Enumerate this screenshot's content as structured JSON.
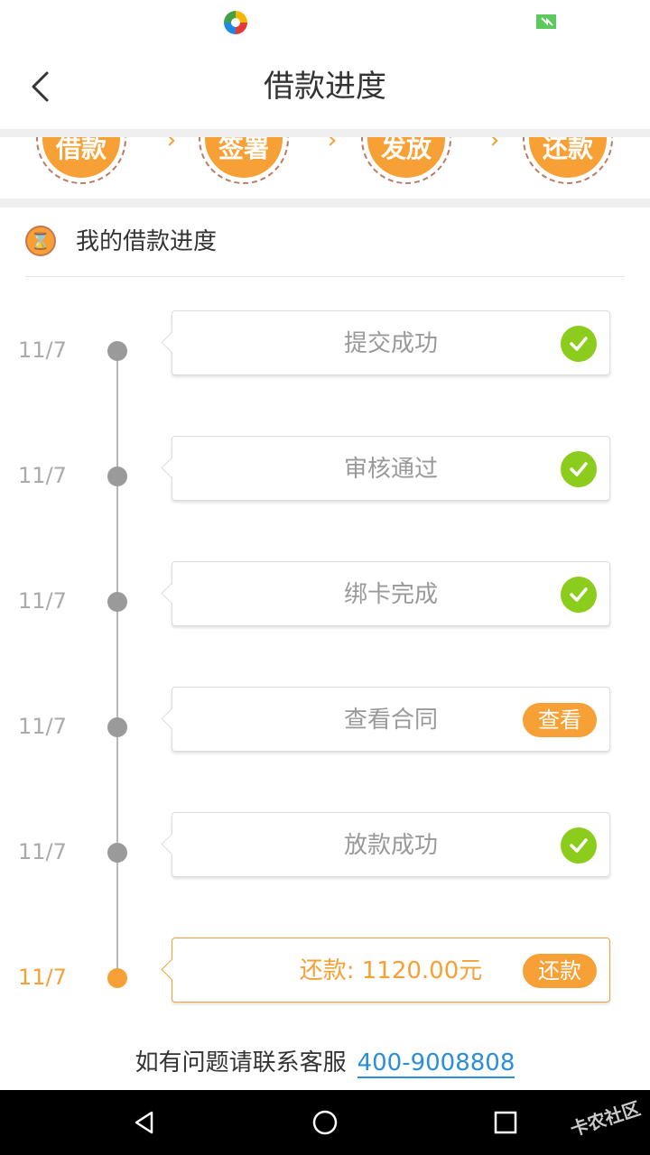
{
  "header": {
    "title": "借款进度"
  },
  "steps": [
    "借款",
    "签署",
    "发放",
    "还款"
  ],
  "section": {
    "title": "我的借款进度"
  },
  "timeline": [
    {
      "date": "11/7",
      "label": "提交成功",
      "status": "done"
    },
    {
      "date": "11/7",
      "label": "审核通过",
      "status": "done"
    },
    {
      "date": "11/7",
      "label": "绑卡完成",
      "status": "done"
    },
    {
      "date": "11/7",
      "label": "查看合同",
      "status": "action",
      "button": "查看"
    },
    {
      "date": "11/7",
      "label": "放款成功",
      "status": "done"
    },
    {
      "date": "11/7",
      "label": "还款: 1120.00元",
      "status": "active",
      "button": "还款"
    }
  ],
  "footer": {
    "text": "如有问题请联系客服",
    "phone": "400-9008808"
  },
  "watermark": "卡农社区",
  "colors": {
    "accent": "#f7a035",
    "check": "#8ccc1c",
    "link": "#2a8fd8"
  }
}
